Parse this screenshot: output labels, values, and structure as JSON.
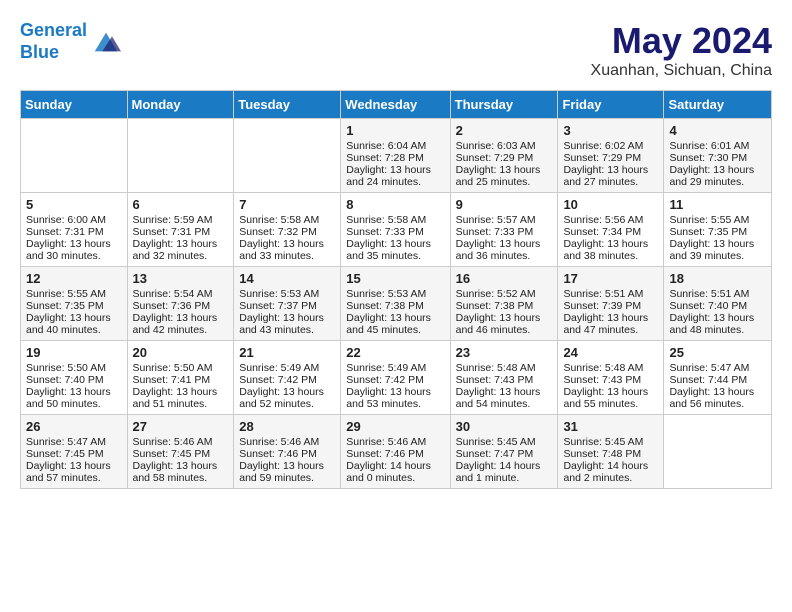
{
  "header": {
    "logo_line1": "General",
    "logo_line2": "Blue",
    "month": "May 2024",
    "location": "Xuanhan, Sichuan, China"
  },
  "weekdays": [
    "Sunday",
    "Monday",
    "Tuesday",
    "Wednesday",
    "Thursday",
    "Friday",
    "Saturday"
  ],
  "weeks": [
    [
      {
        "day": "",
        "content": ""
      },
      {
        "day": "",
        "content": ""
      },
      {
        "day": "",
        "content": ""
      },
      {
        "day": "1",
        "content": "Sunrise: 6:04 AM\nSunset: 7:28 PM\nDaylight: 13 hours and 24 minutes."
      },
      {
        "day": "2",
        "content": "Sunrise: 6:03 AM\nSunset: 7:29 PM\nDaylight: 13 hours and 25 minutes."
      },
      {
        "day": "3",
        "content": "Sunrise: 6:02 AM\nSunset: 7:29 PM\nDaylight: 13 hours and 27 minutes."
      },
      {
        "day": "4",
        "content": "Sunrise: 6:01 AM\nSunset: 7:30 PM\nDaylight: 13 hours and 29 minutes."
      }
    ],
    [
      {
        "day": "5",
        "content": "Sunrise: 6:00 AM\nSunset: 7:31 PM\nDaylight: 13 hours and 30 minutes."
      },
      {
        "day": "6",
        "content": "Sunrise: 5:59 AM\nSunset: 7:31 PM\nDaylight: 13 hours and 32 minutes."
      },
      {
        "day": "7",
        "content": "Sunrise: 5:58 AM\nSunset: 7:32 PM\nDaylight: 13 hours and 33 minutes."
      },
      {
        "day": "8",
        "content": "Sunrise: 5:58 AM\nSunset: 7:33 PM\nDaylight: 13 hours and 35 minutes."
      },
      {
        "day": "9",
        "content": "Sunrise: 5:57 AM\nSunset: 7:33 PM\nDaylight: 13 hours and 36 minutes."
      },
      {
        "day": "10",
        "content": "Sunrise: 5:56 AM\nSunset: 7:34 PM\nDaylight: 13 hours and 38 minutes."
      },
      {
        "day": "11",
        "content": "Sunrise: 5:55 AM\nSunset: 7:35 PM\nDaylight: 13 hours and 39 minutes."
      }
    ],
    [
      {
        "day": "12",
        "content": "Sunrise: 5:55 AM\nSunset: 7:35 PM\nDaylight: 13 hours and 40 minutes."
      },
      {
        "day": "13",
        "content": "Sunrise: 5:54 AM\nSunset: 7:36 PM\nDaylight: 13 hours and 42 minutes."
      },
      {
        "day": "14",
        "content": "Sunrise: 5:53 AM\nSunset: 7:37 PM\nDaylight: 13 hours and 43 minutes."
      },
      {
        "day": "15",
        "content": "Sunrise: 5:53 AM\nSunset: 7:38 PM\nDaylight: 13 hours and 45 minutes."
      },
      {
        "day": "16",
        "content": "Sunrise: 5:52 AM\nSunset: 7:38 PM\nDaylight: 13 hours and 46 minutes."
      },
      {
        "day": "17",
        "content": "Sunrise: 5:51 AM\nSunset: 7:39 PM\nDaylight: 13 hours and 47 minutes."
      },
      {
        "day": "18",
        "content": "Sunrise: 5:51 AM\nSunset: 7:40 PM\nDaylight: 13 hours and 48 minutes."
      }
    ],
    [
      {
        "day": "19",
        "content": "Sunrise: 5:50 AM\nSunset: 7:40 PM\nDaylight: 13 hours and 50 minutes."
      },
      {
        "day": "20",
        "content": "Sunrise: 5:50 AM\nSunset: 7:41 PM\nDaylight: 13 hours and 51 minutes."
      },
      {
        "day": "21",
        "content": "Sunrise: 5:49 AM\nSunset: 7:42 PM\nDaylight: 13 hours and 52 minutes."
      },
      {
        "day": "22",
        "content": "Sunrise: 5:49 AM\nSunset: 7:42 PM\nDaylight: 13 hours and 53 minutes."
      },
      {
        "day": "23",
        "content": "Sunrise: 5:48 AM\nSunset: 7:43 PM\nDaylight: 13 hours and 54 minutes."
      },
      {
        "day": "24",
        "content": "Sunrise: 5:48 AM\nSunset: 7:43 PM\nDaylight: 13 hours and 55 minutes."
      },
      {
        "day": "25",
        "content": "Sunrise: 5:47 AM\nSunset: 7:44 PM\nDaylight: 13 hours and 56 minutes."
      }
    ],
    [
      {
        "day": "26",
        "content": "Sunrise: 5:47 AM\nSunset: 7:45 PM\nDaylight: 13 hours and 57 minutes."
      },
      {
        "day": "27",
        "content": "Sunrise: 5:46 AM\nSunset: 7:45 PM\nDaylight: 13 hours and 58 minutes."
      },
      {
        "day": "28",
        "content": "Sunrise: 5:46 AM\nSunset: 7:46 PM\nDaylight: 13 hours and 59 minutes."
      },
      {
        "day": "29",
        "content": "Sunrise: 5:46 AM\nSunset: 7:46 PM\nDaylight: 14 hours and 0 minutes."
      },
      {
        "day": "30",
        "content": "Sunrise: 5:45 AM\nSunset: 7:47 PM\nDaylight: 14 hours and 1 minute."
      },
      {
        "day": "31",
        "content": "Sunrise: 5:45 AM\nSunset: 7:48 PM\nDaylight: 14 hours and 2 minutes."
      },
      {
        "day": "",
        "content": ""
      }
    ]
  ]
}
